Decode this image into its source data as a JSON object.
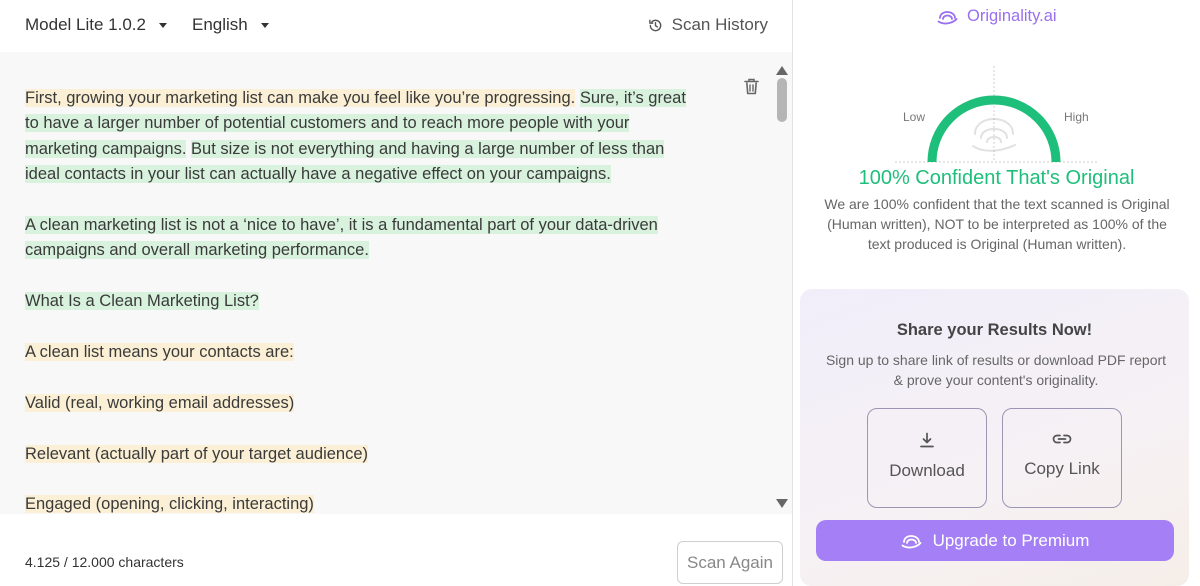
{
  "toolbar": {
    "model_label": "Model Lite 1.0.2",
    "language_label": "English",
    "scan_history_label": "Scan History"
  },
  "editor": {
    "paragraphs": [
      {
        "segments": [
          {
            "text": "First, growing your marketing list can make you feel like you’re progressing.",
            "highlight": "yellow"
          },
          {
            "text": " ",
            "highlight": "none"
          },
          {
            "text": "Sure, it’s great to have a larger number of potential customers and to reach more people with your marketing campaigns.",
            "highlight": "green"
          },
          {
            "text": " ",
            "highlight": "none"
          },
          {
            "text": "But size is not everything and having a large number of less than ideal contacts in your list can actually have a negative effect on your campaigns.",
            "highlight": "green"
          }
        ]
      },
      {
        "segments": [
          {
            "text": "A clean marketing list is not a ‘nice to have’, it is a fundamental part of your data-driven campaigns and overall marketing performance.",
            "highlight": "green"
          }
        ]
      },
      {
        "segments": [
          {
            "text": "What Is a Clean Marketing List?",
            "highlight": "green"
          }
        ]
      },
      {
        "segments": [
          {
            "text": "A clean list means your contacts are:",
            "highlight": "yellow"
          }
        ]
      },
      {
        "segments": [
          {
            "text": "Valid (real, working email addresses)",
            "highlight": "yellow"
          }
        ]
      },
      {
        "segments": [
          {
            "text": "Relevant (actually part of your target audience)",
            "highlight": "yellow"
          }
        ]
      },
      {
        "segments": [
          {
            "text": "Engaged (opening, clicking, interacting)",
            "highlight": "yellow"
          }
        ]
      }
    ]
  },
  "footer": {
    "char_count": "4.125 / 12.000 characters",
    "scan_again_label": "Scan Again"
  },
  "results": {
    "brand_name": "Originality.ai",
    "gauge": {
      "low_label": "Low",
      "high_label": "High",
      "value_fraction": 1.0
    },
    "confidence_title": "100% Confident That's Original",
    "confidence_desc": "We are 100% confident that the text scanned is Original (Human written), NOT to be interpreted as 100% of the text produced is Original (Human written).",
    "share": {
      "title": "Share your Results Now!",
      "desc": "Sign up to share link of results or download PDF report & prove your content's originality.",
      "download_label": "Download",
      "copy_link_label": "Copy Link"
    },
    "upgrade_label": "Upgrade to Premium"
  },
  "colors": {
    "accent_purple": "#a47ff5",
    "brand_purple": "#9a6ff0",
    "original_green": "#1ebf7a",
    "highlight_green": "#d8f2de",
    "highlight_yellow": "#fbf0d5"
  },
  "icons": {
    "model_dropdown": "chevron-down-icon",
    "language_dropdown": "chevron-down-icon",
    "scan_history": "history-icon",
    "delete": "trash-icon",
    "brand": "brain-icon",
    "download": "download-icon",
    "copy_link": "link-icon",
    "upgrade": "brain-icon"
  }
}
